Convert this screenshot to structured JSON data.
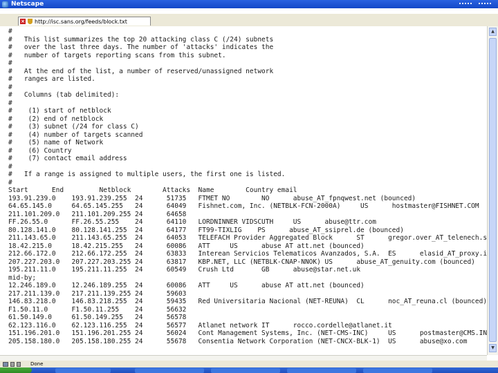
{
  "window": {
    "title": "Netscape"
  },
  "tab": {
    "url": "http://isc.sans.org/feeds/block.txt",
    "close_label": "×"
  },
  "content_lines": [
    "#",
    "#   This list summarizes the top 20 attacking class C (/24) subnets",
    "#   over the last three days. The number of 'attacks' indicates the",
    "#   number of targets reporting scans from this subnet.",
    "#",
    "#   At the end of the list, a number of reserved/unassigned network",
    "#   ranges are listed.",
    "#",
    "#   Columns (tab delimited):",
    "#",
    "#    (1) start of netblock",
    "#    (2) end of netblock",
    "#    (3) subnet (/24 for class C)",
    "#    (4) number of targets scanned",
    "#    (5) name of Network",
    "#    (6) Country",
    "#    (7) contact email address",
    "#",
    "#   If a range is assigned to multiple users, the first one is listed.",
    "#",
    "Start      End         Netblock        Attacks  Name        Country email",
    "193.91.239.0    193.91.239.255  24      51735   FTMET NO        NO      abuse_AT_fpnqwest.net (bounced)",
    "64.65.145.0     64.65.145.255   24      64049   Fishnet.com, Inc. (NETBLK-FCN-2000A)     US      hostmaster@FISHNET.COM",
    "211.101.209.0   211.101.209.255 24      64658",
    "FF.26.55.0      FF.26.55.255    24      64110   LORDNINNER VIDSCUTH     US      abuse@ttr.com",
    "80.128.141.0    80.128.141.255  24      64177   FT99-TIXLIG    PS      abuse_AT_ssiprel.de (bounced)",
    "211.143.65.0    211.143.65.255  24      64053   TELEFACH Provider Aggregated Block      ST      gregor.over_AT_telenech.si",
    "18.42.215.0     18.42.215.255   24      60086   ATT     US      abuse AT att.net (bounced)",
    "212.66.172.0    212.66.172.255  24      63833   Interean Servicios Telematicos Avanzados, S.A.  ES      elasid_AT_proxy.intersan.es",
    "207.227.203.0   207.227.203.255 24      63817   KBP.NET, LLC (NETBLK-CNAP-NNOK) US      abuse_AT_genuity.com (bounced)",
    "195.211.11.0    195.211.11.255  24      60549   Crush Ltd       GB      abuse@star.net.uk",
    "mid-by;",
    "12.246.189.0    12.246.189.255  24      60086   ATT     US      abuse AT att.net (bounced)",
    "217.211.139.0   217.211.139.255 24      59603",
    "146.83.218.0    146.83.218.255  24      59435   Red Universitaria Nacional (NET-REUNA)  CL      noc_AT_reuna.cl (bounced)",
    "F1.50.11.0      F1.50.11.255    24      56632",
    "61.50.149.0     61.50.149.255   24      56578",
    "62.123.116.0    62.123.116.255  24      56577   Atlanet network IT      rocco.cordelle@atlanet.it",
    "151.196.201.0   151.196.201.255 24      56024   Cont Management Systems, Inc. (NET-CMS-INC)     US      postmaster@CMS.INC.COM",
    "205.158.180.0   205.158.180.255 24      55678   Consentia Network Corporation (NET-CNCX-BLK-1)  US      abuse@xo.com"
  ],
  "statusbar": {
    "text": "Done"
  }
}
